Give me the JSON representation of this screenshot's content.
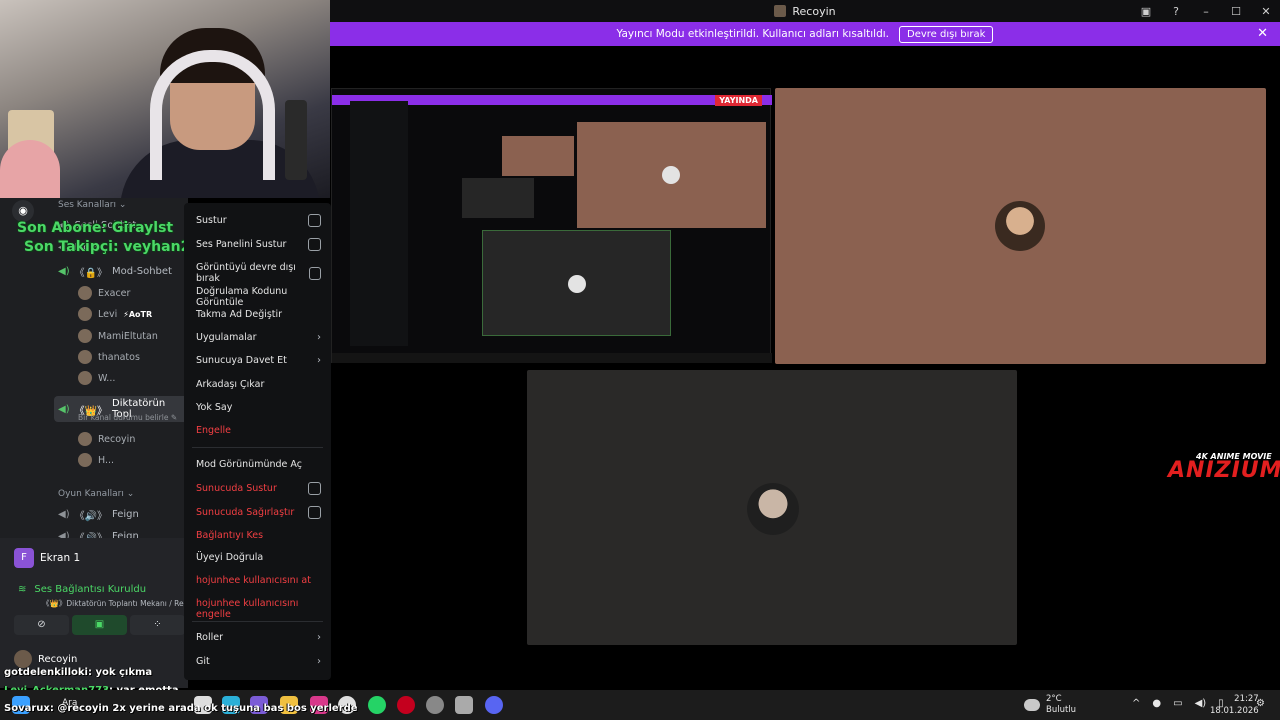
{
  "window": {
    "title": "Recoyin"
  },
  "banner": {
    "text": "Yayıncı Modu etkinleştirildi. Kullanıcı adları kısaltıldı.",
    "button": "Devre dışı bırak",
    "close": "✕"
  },
  "overlay": {
    "last_sub": "Son Abone: Giraylst",
    "last_follow": "Son Takipçi: veyhan24"
  },
  "channels": {
    "category_voice": "Ses Kanalları",
    "category_game": "Oyun Kanalları",
    "items": [
      {
        "label": "Sesli Sohbet"
      },
      {
        "label": "Mola"
      },
      {
        "label": "Mod-Sohbet"
      },
      {
        "label": "Diktatörün Topl"
      }
    ],
    "users_mod": [
      {
        "name": "Exacer",
        "tag": ""
      },
      {
        "name": "Levi",
        "tag": "AoTR"
      },
      {
        "name": "MamiEltutan",
        "tag": ""
      },
      {
        "name": "thanatos",
        "tag": ""
      },
      {
        "name": "W...",
        "tag": ""
      }
    ],
    "selected_hint": "Bir kanal durumu belirle",
    "users_dikt": [
      {
        "name": "Recoyin"
      },
      {
        "name": "H..."
      }
    ],
    "game_items": [
      {
        "label": "Feign"
      },
      {
        "label": "Feign"
      }
    ]
  },
  "voice_panel": {
    "screen_label": "Ekran 1",
    "screen_letter": "F",
    "connected": "Ses Bağlantısı Kuruldu",
    "connected_sub": "《👑》Diktatörün Toplantı Mekanı / Reco",
    "user": "Recoyin"
  },
  "context_menu": {
    "items": [
      {
        "label": "Sustur",
        "kind": "checkbox"
      },
      {
        "label": "Ses Panelini Sustur",
        "kind": "checkbox"
      },
      {
        "label": "Görüntüyü devre dışı bırak",
        "kind": "checkbox"
      },
      {
        "label": "Doğrulama Kodunu Görüntüle",
        "kind": "plain"
      },
      {
        "label": "Takma Ad Değiştir",
        "kind": "plain"
      },
      {
        "label": "Uygulamalar",
        "kind": "submenu"
      },
      {
        "label": "Sunucuya Davet Et",
        "kind": "submenu"
      },
      {
        "label": "Arkadaşı Çıkar",
        "kind": "plain"
      },
      {
        "label": "Yok Say",
        "kind": "plain"
      },
      {
        "label": "Engelle",
        "kind": "danger"
      },
      {
        "label": "Mod Görünümünde Aç",
        "kind": "plain"
      },
      {
        "label": "Sunucuda Sustur",
        "kind": "danger-checkbox"
      },
      {
        "label": "Sunucuda Sağırlaştır",
        "kind": "danger-checkbox"
      },
      {
        "label": "Bağlantıyı Kes",
        "kind": "danger"
      },
      {
        "label": "Üyeyi Doğrula",
        "kind": "plain"
      },
      {
        "label": "hojunhee kullanıcısını at",
        "kind": "danger"
      },
      {
        "label": "hojunhee kullanıcısını engelle",
        "kind": "danger"
      },
      {
        "label": "Roller",
        "kind": "submenu"
      },
      {
        "label": "Git",
        "kind": "submenu"
      }
    ]
  },
  "stream": {
    "live_badge": "YAYINDA"
  },
  "logo": {
    "top": "4K ANIME MOVIE",
    "main": "ANIZIUM"
  },
  "chat": [
    {
      "nick": "gotdelenkilloki",
      "msg": ": yok çıkma"
    },
    {
      "nick": "Levi_Ackerman773",
      "msg": ": var emotta"
    },
    {
      "nick": "Sovarux",
      "msg": ": @recoyin 2x yerine arada ok tuşuna bas bos yerlerde"
    }
  ],
  "taskbar": {
    "search": "Ara",
    "temp": "2°C",
    "weather": "Bulutlu",
    "time": "21:27",
    "date": "18.01.2026"
  },
  "colors": {
    "banner": "#8b2ee8",
    "danger": "#f23f43",
    "connected": "#4bd866",
    "tile_brown": "#8b6150"
  }
}
